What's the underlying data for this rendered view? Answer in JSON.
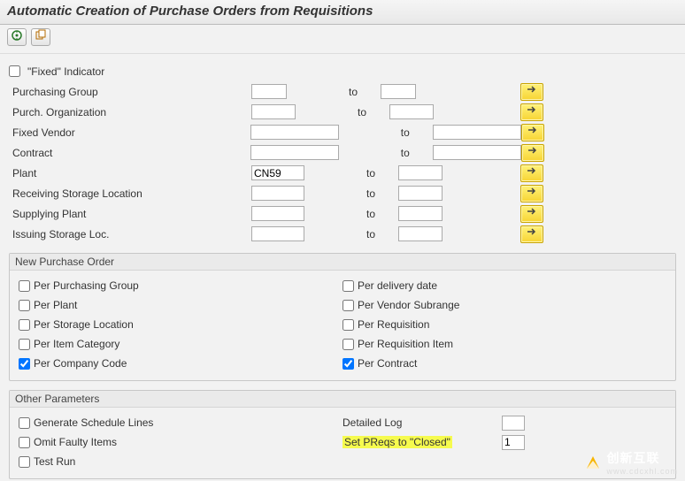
{
  "title": "Automatic Creation of Purchase Orders from Requisitions",
  "toolbar": {
    "execute_icon": "execute-icon",
    "variant_icon": "variant-icon"
  },
  "fixed_indicator": {
    "label": "\"Fixed\" Indicator",
    "checked": false
  },
  "selection": {
    "to_label": "to",
    "rows": [
      {
        "key": "purch_group",
        "label": "Purchasing Group",
        "from": "",
        "to": "",
        "w1": 40,
        "w2": 40
      },
      {
        "key": "purch_org",
        "label": "Purch. Organization",
        "from": "",
        "to": "",
        "w1": 50,
        "w2": 50
      },
      {
        "key": "fixed_vendor",
        "label": "Fixed Vendor",
        "from": "",
        "to": "",
        "w1": 100,
        "w2": 100
      },
      {
        "key": "contract",
        "label": "Contract",
        "from": "",
        "to": "",
        "w1": 100,
        "w2": 100
      },
      {
        "key": "plant",
        "label": "Plant",
        "from": "CN59",
        "to": "",
        "w1": 60,
        "w2": 50
      },
      {
        "key": "recv_sloc",
        "label": "Receiving Storage Location",
        "from": "",
        "to": "",
        "w1": 60,
        "w2": 50
      },
      {
        "key": "supp_plant",
        "label": "Supplying Plant",
        "from": "",
        "to": "",
        "w1": 60,
        "w2": 50
      },
      {
        "key": "issu_sloc",
        "label": "Issuing Storage Loc.",
        "from": "",
        "to": "",
        "w1": 60,
        "w2": 50
      }
    ]
  },
  "group_newpo": {
    "legend": "New Purchase Order",
    "left": [
      {
        "key": "per_pgroup",
        "label": "Per Purchasing Group",
        "checked": false
      },
      {
        "key": "per_plant",
        "label": "Per Plant",
        "checked": false
      },
      {
        "key": "per_sloc",
        "label": "Per Storage Location",
        "checked": false
      },
      {
        "key": "per_itemcat",
        "label": "Per Item Category",
        "checked": false
      },
      {
        "key": "per_cocode",
        "label": "Per Company Code",
        "checked": true
      }
    ],
    "right": [
      {
        "key": "per_deldate",
        "label": "Per delivery date",
        "checked": false
      },
      {
        "key": "per_vsubr",
        "label": "Per Vendor Subrange",
        "checked": false
      },
      {
        "key": "per_req",
        "label": "Per Requisition",
        "checked": false
      },
      {
        "key": "per_reqitem",
        "label": "Per Requisition Item",
        "checked": false
      },
      {
        "key": "per_contract",
        "label": "Per Contract",
        "checked": true
      }
    ]
  },
  "group_other": {
    "legend": "Other Parameters",
    "left": [
      {
        "key": "gen_sched",
        "label": "Generate Schedule Lines",
        "checked": false
      },
      {
        "key": "omit_fault",
        "label": "Omit Faulty Items",
        "checked": false
      },
      {
        "key": "test_run",
        "label": "Test Run",
        "checked": false
      }
    ],
    "right": {
      "detailed_log": {
        "label": "Detailed Log",
        "value": ""
      },
      "set_preqs": {
        "label": "Set PReqs to \"Closed\"",
        "value": "1",
        "highlight": true
      }
    }
  },
  "watermark": {
    "main": "创新互联",
    "sub": "www.cdcxhl.com"
  }
}
